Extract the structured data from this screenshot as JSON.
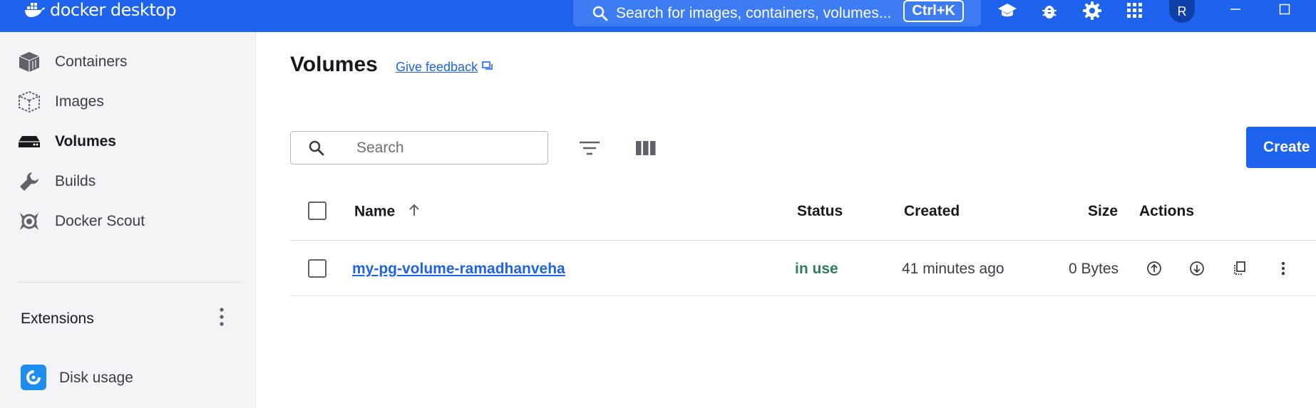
{
  "app": {
    "brand": "docker desktop",
    "global_search_placeholder": "Search for images, containers, volumes...",
    "global_search_shortcut": "Ctrl+K",
    "user_initial": "R",
    "accent_color": "#1d63ed"
  },
  "topbar_icons": [
    "learning-center-icon",
    "troubleshoot-bug-icon",
    "settings-gear-icon",
    "extensions-grid-icon"
  ],
  "sidebar": {
    "items": [
      {
        "label": "Containers",
        "icon": "containers-icon",
        "active": false
      },
      {
        "label": "Images",
        "icon": "images-icon",
        "active": false
      },
      {
        "label": "Volumes",
        "icon": "volumes-icon",
        "active": true
      },
      {
        "label": "Builds",
        "icon": "wrench-icon",
        "active": false
      },
      {
        "label": "Docker Scout",
        "icon": "docker-scout-icon",
        "active": false
      }
    ],
    "extensions_label": "Extensions",
    "extension_items": [
      {
        "label": "Disk usage",
        "icon": "disk-usage-icon"
      }
    ]
  },
  "main": {
    "title": "Volumes",
    "feedback_link": "Give feedback",
    "search_placeholder": "Search",
    "create_button": "Create",
    "table": {
      "columns": [
        "Name",
        "Status",
        "Created",
        "Size",
        "Actions"
      ],
      "sort_column": "Name",
      "sort_direction": "ascending",
      "rows": [
        {
          "name": "my-pg-volume-ramadhanveha",
          "status": "in use",
          "created": "41 minutes ago",
          "size": "0 Bytes"
        }
      ]
    },
    "status_color_in_use": "#2e7d5b"
  }
}
